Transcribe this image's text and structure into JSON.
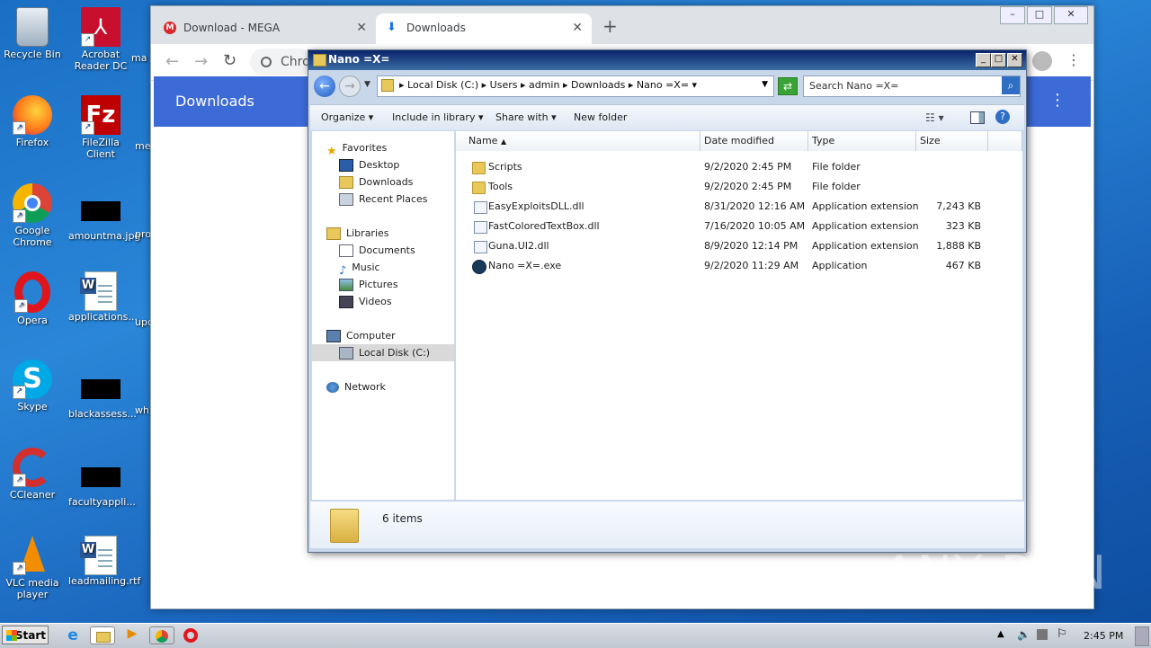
{
  "desktop": {
    "col1": [
      {
        "label": "Recycle Bin"
      },
      {
        "label": "Firefox"
      },
      {
        "label": "Google Chrome"
      },
      {
        "label": "Opera"
      },
      {
        "label": "Skype"
      },
      {
        "label": "CCleaner"
      },
      {
        "label": "VLC media player"
      }
    ],
    "col2": [
      {
        "label": "Acrobat Reader DC"
      },
      {
        "label": "FileZilla Client"
      },
      {
        "label": "amountma.jpg"
      },
      {
        "label": "applications..."
      },
      {
        "label": "blackassess..."
      },
      {
        "label": "facultyappli..."
      },
      {
        "label": "leadmailing.rtf"
      }
    ],
    "col3": [
      "ma",
      "me",
      "pro",
      "upc",
      "wh"
    ]
  },
  "chrome": {
    "tabs": [
      {
        "label": "Download - MEGA"
      },
      {
        "label": "Downloads"
      }
    ],
    "new_tab": "+",
    "omnibox_partial": "Chro",
    "downloads_title": "Downloads"
  },
  "explorer": {
    "title": "Nano =X=",
    "breadcrumb": [
      "Local Disk (C:)",
      "Users",
      "admin",
      "Downloads",
      "Nano =X="
    ],
    "search_placeholder": "Search Nano =X=",
    "commands": {
      "organize": "Organize",
      "include": "Include in library",
      "share": "Share with",
      "new_folder": "New folder"
    },
    "nav": {
      "favorites": "Favorites",
      "desktop": "Desktop",
      "downloads": "Downloads",
      "recent": "Recent Places",
      "libraries": "Libraries",
      "documents": "Documents",
      "music": "Music",
      "pictures": "Pictures",
      "videos": "Videos",
      "computer": "Computer",
      "local_disk": "Local Disk (C:)",
      "network": "Network"
    },
    "columns": {
      "name": "Name",
      "date": "Date modified",
      "type": "Type",
      "size": "Size"
    },
    "files": [
      {
        "name": "Scripts",
        "date": "9/2/2020 2:45 PM",
        "type": "File folder",
        "size": "",
        "kind": "folder"
      },
      {
        "name": "Tools",
        "date": "9/2/2020 2:45 PM",
        "type": "File folder",
        "size": "",
        "kind": "folder"
      },
      {
        "name": "EasyExploitsDLL.dll",
        "date": "8/31/2020 12:16 AM",
        "type": "Application extension",
        "size": "7,243 KB",
        "kind": "dll"
      },
      {
        "name": "FastColoredTextBox.dll",
        "date": "7/16/2020 10:05 AM",
        "type": "Application extension",
        "size": "323 KB",
        "kind": "dll"
      },
      {
        "name": "Guna.UI2.dll",
        "date": "8/9/2020 12:14 PM",
        "type": "Application extension",
        "size": "1,888 KB",
        "kind": "dll"
      },
      {
        "name": "Nano =X=.exe",
        "date": "9/2/2020 11:29 AM",
        "type": "Application",
        "size": "467 KB",
        "kind": "exe"
      }
    ],
    "item_count": "6 items"
  },
  "taskbar": {
    "start_label": "Start",
    "clock": "2:45 PM"
  },
  "watermark": "ANY RUN"
}
